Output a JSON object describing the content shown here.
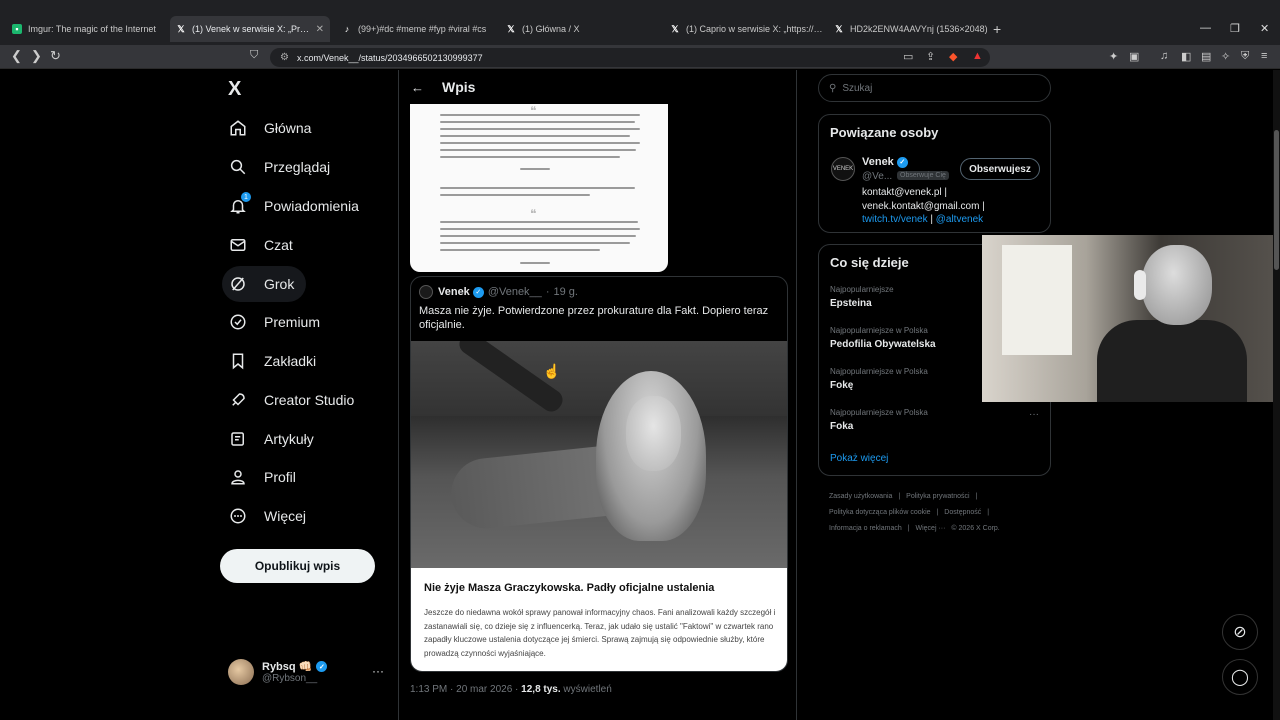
{
  "browser": {
    "tabs": [
      {
        "title": "Imgur: The magic of the Internet",
        "icon": "imgur-icon",
        "active": false
      },
      {
        "title": "(1) Venek w serwisie X: „Prokurat",
        "icon": "x-icon",
        "active": true
      },
      {
        "title": "(99+)#dc #meme #fyp #viral #cs",
        "icon": "tiktok-icon",
        "active": false
      },
      {
        "title": "(1) Główna / X",
        "icon": "x-icon",
        "active": false
      },
      {
        "title": "(1) Caprio w serwisie X: „https://t.co/",
        "icon": "x-icon",
        "active": false
      },
      {
        "title": "HD2k2ENW4AAVYnj (1536×2048)",
        "icon": "x-icon",
        "active": false
      }
    ],
    "url": "x.com/Venek__/status/2034966502130999377"
  },
  "nav": {
    "logo": "X",
    "items": [
      {
        "label": "Główna",
        "icon": "home-icon"
      },
      {
        "label": "Przeglądaj",
        "icon": "search-icon"
      },
      {
        "label": "Powiadomienia",
        "icon": "bell-icon",
        "badge": "1"
      },
      {
        "label": "Czat",
        "icon": "mail-icon"
      },
      {
        "label": "Grok",
        "icon": "grok-icon"
      },
      {
        "label": "Premium",
        "icon": "premium-icon"
      },
      {
        "label": "Zakładki",
        "icon": "bookmark-icon"
      },
      {
        "label": "Creator Studio",
        "icon": "rocket-icon"
      },
      {
        "label": "Artykuły",
        "icon": "article-icon"
      },
      {
        "label": "Profil",
        "icon": "person-icon"
      },
      {
        "label": "Więcej",
        "icon": "more-circle-icon"
      }
    ],
    "post_button": "Opublikuj wpis",
    "account": {
      "name": "Rybsq 👊🏻",
      "handle": "@Rybson__"
    }
  },
  "main": {
    "header_title": "Wpis",
    "quote": {
      "name": "Venek",
      "handle": "@Venek__",
      "time": "19 g.",
      "text": "Masza nie żyje. Potwierdzone przez prokurature dla Fakt. Dopiero teraz oficjalnie.",
      "article_title": "Nie żyje Masza Graczykowska. Padły oficjalne ustalenia",
      "article_body": "Jeszcze do niedawna wokół sprawy panował informacyjny chaos. Fani analizowali każdy szczegół i zastanawiali się, co dzieje się z influencerką. Teraz, jak udało się ustalić \"Faktowi\" w czwartek rano zapadły kluczowe ustalenia dotyczące jej śmierci. Sprawą zajmują się odpowiednie służby, które prowadzą czynności wyjaśniające."
    },
    "post_time": "1:13 PM · 20 mar 2026 · ",
    "views_count": "12,8 tys.",
    "views_label": " wyświetleń"
  },
  "right": {
    "search_placeholder": "Szukaj",
    "related_title": "Powiązane osoby",
    "related": {
      "name": "Venek",
      "handle": "@Ve...",
      "follows_you": "Obserwuje Cię",
      "button": "Obserwujesz",
      "bio_1": "kontakt@venek.pl |",
      "bio_2": "venek.kontakt@gmail.com |",
      "bio_link_1": "twitch.tv/venek",
      "bio_sep": " | ",
      "bio_link_2": "@altvenek"
    },
    "happening_title": "Co się dzieje",
    "trends": [
      {
        "context": "Najpopularniejsze",
        "name": "Epsteina"
      },
      {
        "context": "Najpopularniejsze w Polska",
        "name": "Pedofilia Obywatelska"
      },
      {
        "context": "Najpopularniejsze w Polska",
        "name": "Fokę"
      },
      {
        "context": "Najpopularniejsze w Polska",
        "name": "Foka"
      }
    ],
    "show_more": "Pokaż więcej",
    "footer": [
      "Zasady użytkowania",
      "|",
      "Polityka prywatności",
      "|",
      "Polityka dotycząca plików cookie",
      "|",
      "Dostępność",
      "|",
      "Informacja o reklamach",
      "|",
      "Więcej ···",
      "© 2026 X Corp."
    ]
  },
  "colors": {
    "accent": "#1d9bf0",
    "background": "#000000",
    "border": "#2f3336",
    "muted": "#71767b"
  }
}
